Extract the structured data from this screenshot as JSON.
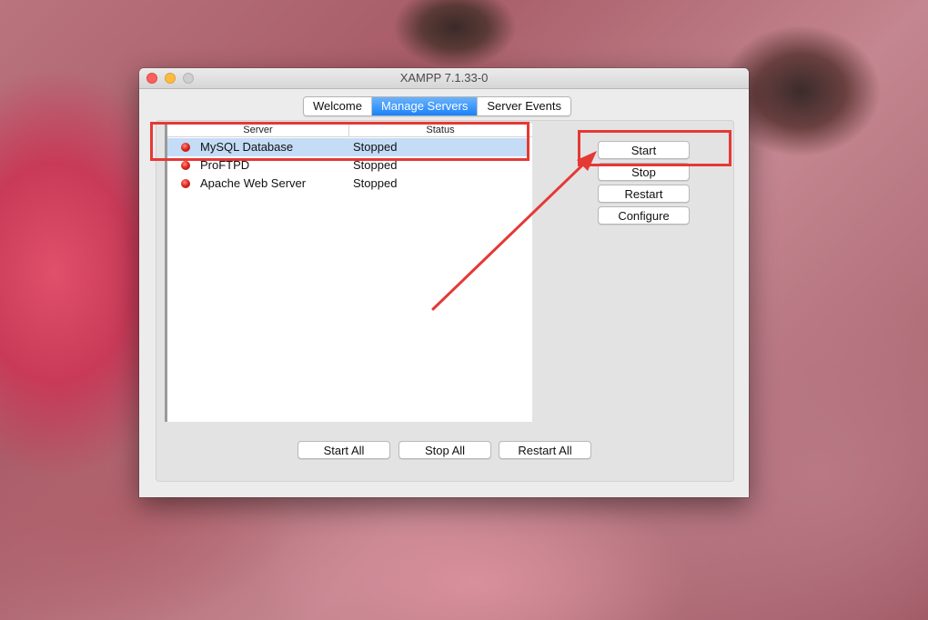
{
  "window": {
    "title": "XAMPP 7.1.33-0",
    "traffic_lights": [
      "close",
      "minimize",
      "zoom"
    ]
  },
  "tabs": [
    {
      "label": "Welcome",
      "active": false
    },
    {
      "label": "Manage Servers",
      "active": true
    },
    {
      "label": "Server Events",
      "active": false
    }
  ],
  "table": {
    "columns": [
      "Server",
      "Status"
    ],
    "rows": [
      {
        "name": "MySQL Database",
        "status": "Stopped",
        "selected": true,
        "indicator": "red-dot-icon"
      },
      {
        "name": "ProFTPD",
        "status": "Stopped",
        "selected": false,
        "indicator": "red-dot-icon"
      },
      {
        "name": "Apache Web Server",
        "status": "Stopped",
        "selected": false,
        "indicator": "red-dot-icon"
      }
    ]
  },
  "side_buttons": {
    "start": "Start",
    "stop": "Stop",
    "restart": "Restart",
    "configure": "Configure"
  },
  "bottom_buttons": {
    "start_all": "Start All",
    "stop_all": "Stop All",
    "restart_all": "Restart All"
  },
  "colors": {
    "accent": "#1a82fb",
    "selection": "#c4dcf6",
    "annotation": "#e53935",
    "stopped_indicator": "#e02a20"
  }
}
